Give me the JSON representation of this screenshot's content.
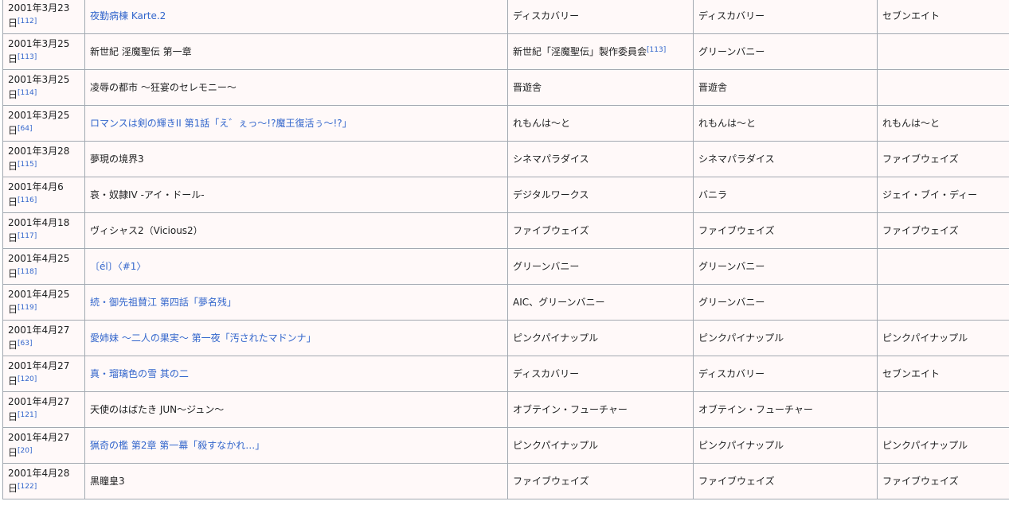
{
  "rows": [
    {
      "date_line1": "2001年3月23",
      "date_line2": "日",
      "ref": "[112]",
      "title": "夜勤病棟 Karte.2",
      "title_linked": true,
      "production": "ディスカバリー",
      "production_ref": "",
      "brand": "ディスカバリー",
      "distributor": "セブンエイト"
    },
    {
      "date_line1": "2001年3月25",
      "date_line2": "日",
      "ref": "[113]",
      "title": "新世紀 淫魔聖伝 第一章",
      "title_linked": false,
      "production": "新世紀「淫魔聖伝」製作委員会",
      "production_ref": "[113]",
      "brand": "グリーンバニー",
      "distributor": ""
    },
    {
      "date_line1": "2001年3月25",
      "date_line2": "日",
      "ref": "[114]",
      "title": "凌辱の都市 〜狂宴のセレモニー〜",
      "title_linked": false,
      "production": "晋遊舎",
      "production_ref": "",
      "brand": "晋遊舎",
      "distributor": ""
    },
    {
      "date_line1": "2001年3月25",
      "date_line2": "日",
      "ref": "[64]",
      "title": "ロマンスは剣の輝きII 第1話「え゛ぇっ〜!?魔王復活ぅ〜!?」",
      "title_linked": true,
      "production": "れもんは〜と",
      "production_ref": "",
      "brand": "れもんは〜と",
      "distributor": "れもんは〜と"
    },
    {
      "date_line1": "2001年3月28",
      "date_line2": "日",
      "ref": "[115]",
      "title": "夢現の境界3",
      "title_linked": false,
      "production": "シネマパラダイス",
      "production_ref": "",
      "brand": "シネマパラダイス",
      "distributor": "ファイブウェイズ"
    },
    {
      "date_line1": "2001年4月6",
      "date_line2": "日",
      "ref": "[116]",
      "title": "哀・奴隷IV -アイ・ドール-",
      "title_linked": false,
      "production": "デジタルワークス",
      "production_ref": "",
      "brand": "バニラ",
      "distributor": "ジェイ・ブイ・ディー"
    },
    {
      "date_line1": "2001年4月18",
      "date_line2": "日",
      "ref": "[117]",
      "title": "ヴィシャス2（Vicious2）",
      "title_linked": false,
      "production": "ファイブウェイズ",
      "production_ref": "",
      "brand": "ファイブウェイズ",
      "distributor": "ファイブウェイズ"
    },
    {
      "date_line1": "2001年4月25",
      "date_line2": "日",
      "ref": "[118]",
      "title": "〔él〕〈#1〉",
      "title_linked": true,
      "production": "グリーンバニー",
      "production_ref": "",
      "brand": "グリーンバニー",
      "distributor": ""
    },
    {
      "date_line1": "2001年4月25",
      "date_line2": "日",
      "ref": "[119]",
      "title": "続・御先祖賛江 第四話「夢名残」",
      "title_linked": true,
      "production": "AIC、グリーンバニー",
      "production_ref": "",
      "brand": "グリーンバニー",
      "distributor": ""
    },
    {
      "date_line1": "2001年4月27",
      "date_line2": "日",
      "ref": "[63]",
      "title": "愛姉妹 〜二人の果実〜 第一夜「汚されたマドンナ」",
      "title_linked": true,
      "production": "ピンクパイナップル",
      "production_ref": "",
      "brand": "ピンクパイナップル",
      "distributor": "ピンクパイナップル"
    },
    {
      "date_line1": "2001年4月27",
      "date_line2": "日",
      "ref": "[120]",
      "title": "真・瑠璃色の雪 其の二",
      "title_linked": true,
      "production": "ディスカバリー",
      "production_ref": "",
      "brand": "ディスカバリー",
      "distributor": "セブンエイト"
    },
    {
      "date_line1": "2001年4月27",
      "date_line2": "日",
      "ref": "[121]",
      "title": "天使のはばたき JUN〜ジュン〜",
      "title_linked": false,
      "production": "オブテイン・フューチャー",
      "production_ref": "",
      "brand": "オブテイン・フューチャー",
      "distributor": ""
    },
    {
      "date_line1": "2001年4月27",
      "date_line2": "日",
      "ref": "[20]",
      "title": "猟奇の檻 第2章 第一幕「殺すなかれ…」",
      "title_linked": true,
      "production": "ピンクパイナップル",
      "production_ref": "",
      "brand": "ピンクパイナップル",
      "distributor": "ピンクパイナップル"
    },
    {
      "date_line1": "2001年4月28",
      "date_line2": "日",
      "ref": "[122]",
      "title": "黒瞳皇3",
      "title_linked": false,
      "production": "ファイブウェイズ",
      "production_ref": "",
      "brand": "ファイブウェイズ",
      "distributor": "ファイブウェイズ"
    }
  ]
}
